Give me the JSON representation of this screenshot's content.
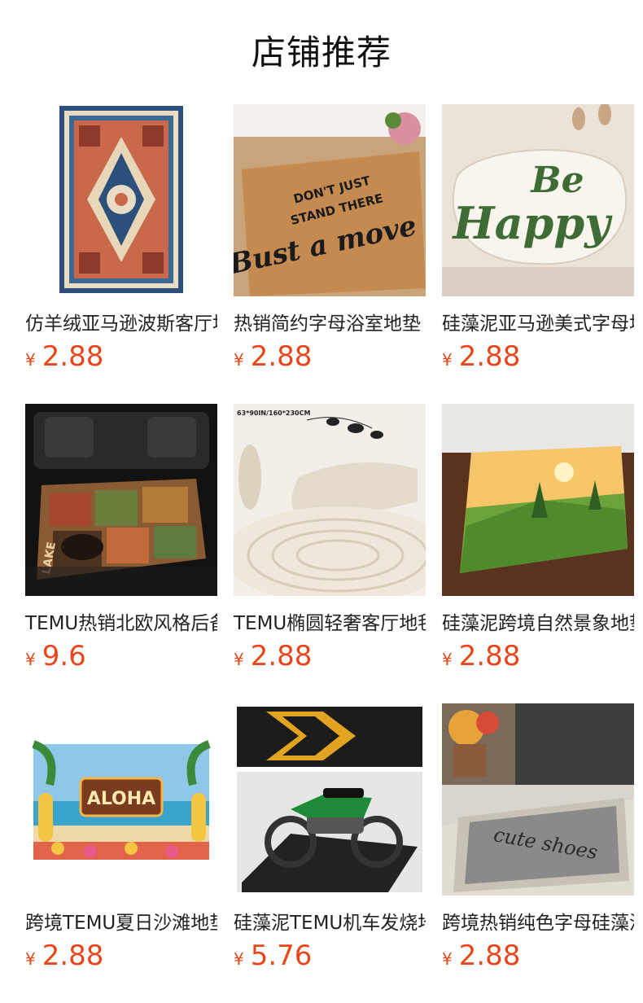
{
  "header": {
    "title": "店铺推荐"
  },
  "colors": {
    "price": "#e8471c"
  },
  "products": [
    {
      "name": "仿羊绒亚马逊波斯客厅地毯",
      "currency": "¥",
      "price": "2.88",
      "image_icon": "persian-rug-image"
    },
    {
      "name": "热销简约字母浴室地垫",
      "currency": "¥",
      "price": "2.88",
      "image_icon": "doormat-image",
      "image_text": "DON'T JUST STAND THERE Bust a move"
    },
    {
      "name": "硅藻泥亚马逊美式字母地垫",
      "currency": "¥",
      "price": "2.88",
      "image_icon": "be-happy-mat-image",
      "image_text": "Be Happy"
    },
    {
      "name": "TEMU热销北欧风格后备箱垫",
      "currency": "¥",
      "price": "9.6",
      "image_icon": "trunk-mat-image",
      "image_text": "LAKE"
    },
    {
      "name": "TEMU椭圆轻奢客厅地毯",
      "currency": "¥",
      "price": "2.88",
      "image_icon": "oval-rug-image",
      "image_text": "63*90IN/160*230CM"
    },
    {
      "name": "硅藻泥跨境自然景象地垫",
      "currency": "¥",
      "price": "2.88",
      "image_icon": "landscape-mat-image"
    },
    {
      "name": "跨境TEMU夏日沙滩地垫",
      "currency": "¥",
      "price": "2.88",
      "image_icon": "aloha-mat-image",
      "image_text": "ALOHA"
    },
    {
      "name": "硅藻泥TEMU机车发烧地垫",
      "currency": "¥",
      "price": "5.76",
      "image_icon": "motorcycle-mat-image"
    },
    {
      "name": "跨境热销纯色字母硅藻泥地垫",
      "currency": "¥",
      "price": "2.88",
      "image_icon": "cute-shoes-mat-image",
      "image_text": "cute shoes"
    }
  ]
}
